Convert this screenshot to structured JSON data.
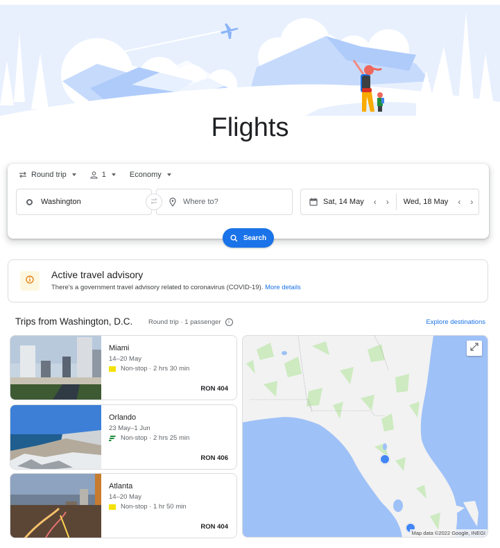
{
  "page": {
    "title": "Flights"
  },
  "search": {
    "trip_type": "Round trip",
    "passengers": "1",
    "cabin_class": "Economy",
    "origin": "Washington",
    "destination_placeholder": "Where to?",
    "depart_date": "Sat, 14 May",
    "return_date": "Wed, 18 May",
    "search_label": "Search"
  },
  "advisory": {
    "title": "Active travel advisory",
    "text": "There's a government travel advisory related to coronavirus (COVID-19).",
    "link": "More details"
  },
  "trips": {
    "title": "Trips from Washington, D.C.",
    "subtitle": "Round trip · 1 passenger",
    "info_icon": "i",
    "explore_label": "Explore destinations",
    "items": [
      {
        "city": "Miami",
        "dates": "14–20 May",
        "flight": "Non-stop · 2 hrs 30 min",
        "price": "RON 404",
        "airline_color": "#f5e10a"
      },
      {
        "city": "Orlando",
        "dates": "23 May–1 Jun",
        "flight": "Non-stop · 2 hrs 25 min",
        "price": "RON 406",
        "airline_color": "#1e8e3e"
      },
      {
        "city": "Atlanta",
        "dates": "14–20 May",
        "flight": "Non-stop · 1 hr 50 min",
        "price": "RON 404",
        "airline_color": "#f5e10a"
      }
    ]
  },
  "map": {
    "attribution": "Map data ©2022 Google, INEGI",
    "pins": [
      "Orlando",
      "Miami"
    ]
  },
  "colors": {
    "accent": "#1a73e8",
    "advisory_icon": "#e37400",
    "advisory_bg": "#fef7e0",
    "map_water": "#9ec1f7",
    "map_land": "#f2f2f2",
    "map_park": "#cdeac0"
  }
}
